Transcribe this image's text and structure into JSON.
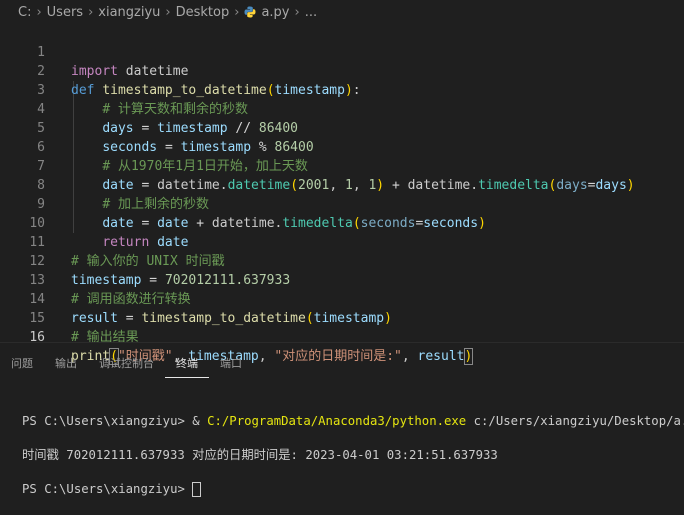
{
  "breadcrumb": {
    "items": [
      "C:",
      "Users",
      "xiangziyu",
      "Desktop"
    ],
    "file": "a.py",
    "more": "..."
  },
  "editor": {
    "active_line": 16,
    "lines": [
      {
        "n": "1"
      },
      {
        "n": "2"
      },
      {
        "n": "3"
      },
      {
        "n": "4"
      },
      {
        "n": "5"
      },
      {
        "n": "6"
      },
      {
        "n": "7"
      },
      {
        "n": "8"
      },
      {
        "n": "9"
      },
      {
        "n": "10"
      },
      {
        "n": "11"
      },
      {
        "n": "12"
      },
      {
        "n": "13"
      },
      {
        "n": "14"
      },
      {
        "n": "15"
      },
      {
        "n": "16"
      }
    ],
    "tokens": {
      "import_kw": "import",
      "datetime_mod": "datetime",
      "def_kw": "def",
      "func_name": "timestamp_to_datetime",
      "param": "timestamp",
      "c_calc": "# 计算天数和剩余的秒数",
      "days": "days",
      "timestamp": "timestamp",
      "floordiv": "//",
      "n86400": "86400",
      "seconds": "seconds",
      "mod": "%",
      "c_from": "# 从1970年1月1日开始，加上天数",
      "date": "date",
      "datetime": "datetime",
      "datetime_cls": "datetime",
      "n2001": "2001",
      "n1": "1",
      "timedelta": "timedelta",
      "days_kw": "days",
      "c_add": "# 加上剩余的秒数",
      "seconds_kw": "seconds",
      "return_kw": "return",
      "c_input": "# 输入你的 UNIX 时间戳",
      "ts_value": "702012111.637933",
      "c_call": "# 调用函数进行转换",
      "result": "result",
      "c_out": "# 输出结果",
      "print": "print",
      "s_label": "\"时间戳\"",
      "s_label2": "\"对应的日期时间是:\""
    }
  },
  "panel": {
    "tabs": [
      "问题",
      "输出",
      "调试控制台",
      "终端",
      "端口"
    ],
    "active_tab": "终端"
  },
  "terminal": {
    "prompt1": "PS C:\\Users\\xiangziyu> & ",
    "cmd_exe": "C:/ProgramData/Anaconda3/python.exe",
    "cmd_arg": " c:/Users/xiangziyu/Desktop/a.py",
    "output": "时间戳 702012111.637933 对应的日期时间是: 2023-04-01 03:21:51.637933",
    "prompt2": "PS C:\\Users\\xiangziyu> "
  },
  "colors": {
    "background": "#1f1f1f",
    "keyword": "#c586c0",
    "function": "#dcdcaa",
    "variable": "#9cdcfe",
    "number": "#b5cea8",
    "comment": "#6a9955",
    "string": "#ce9178",
    "type": "#4ec9b0",
    "terminal_command": "#e5e510"
  },
  "icons": {
    "file_icon": "python-file-icon",
    "chevron": "chevron-right-icon"
  }
}
